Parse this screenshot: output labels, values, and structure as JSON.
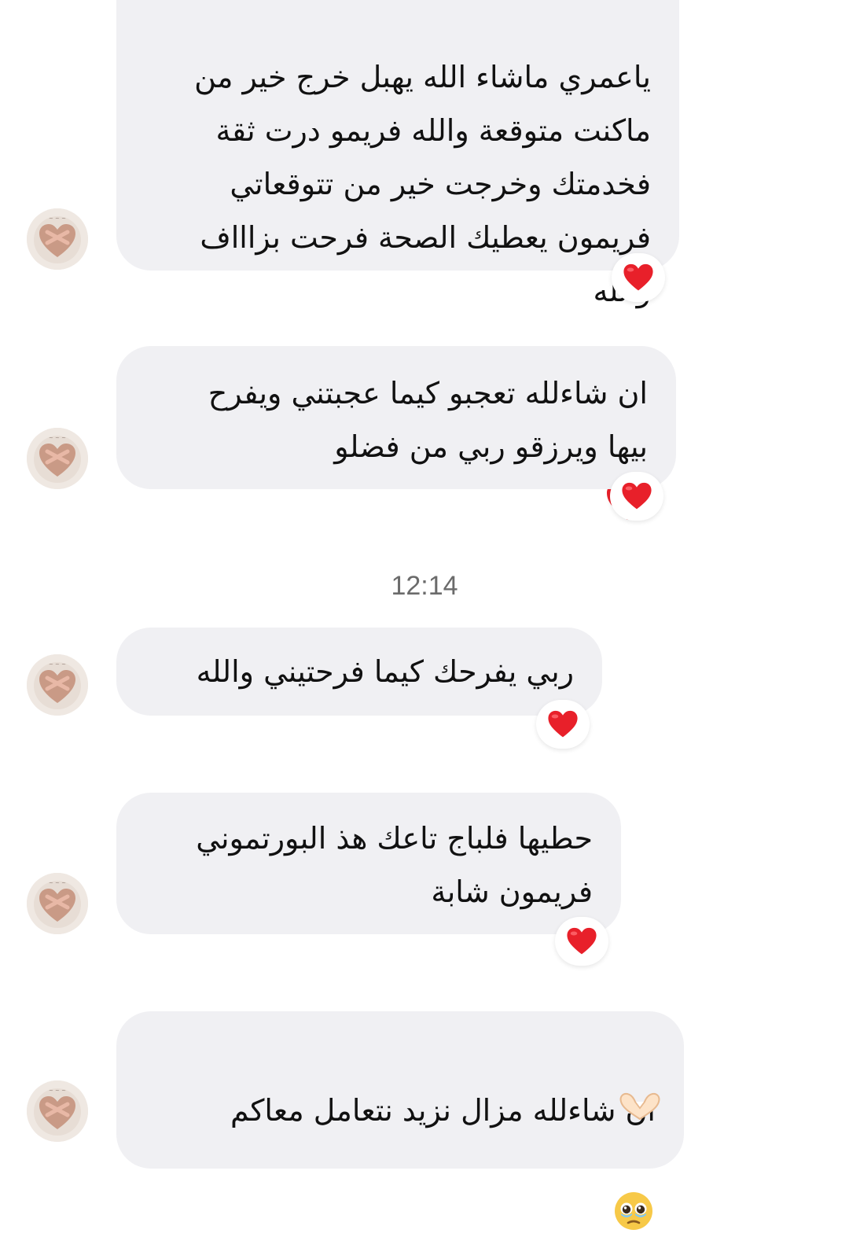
{
  "timestamp": "12:14",
  "messages": [
    {
      "lines": "ياعمري ماشاء الله يهبل خرج خير من\nماكنت متوقعة والله فريمو درت ثقة\nفخدمتك وخرجت خير من تتوقعاتي\nفريمون يعطيك الصحة فرحت بزاااف\nوالله",
      "trailing_emojis": [
        "pleading-face",
        "red-heart"
      ],
      "reaction": "red-heart"
    },
    {
      "lines": "ان شاءلله تعجبو كيما عجبتني ويفرح\nبيها ويرزقو ربي من فضلو",
      "trailing_emojis": [],
      "reaction": "red-heart"
    },
    {
      "lines": "ربي يفرحك كيما فرحتيني والله",
      "trailing_emojis": [],
      "reaction": "red-heart"
    },
    {
      "lines": "حطيها فلباج تاعك هذ البورتموني\nفريمون شابة",
      "trailing_emojis": [],
      "reaction": "red-heart"
    },
    {
      "lines": "ان شاءلله مزال نزيد نتعامل معاكم",
      "trailing_emojis": [
        "face-holding-back-tears"
      ],
      "reaction": "heart-hands"
    }
  ],
  "colors": {
    "bubble": "#f0f0f3",
    "text": "#111111",
    "timestamp": "#6b6b6b",
    "heart": "#e8202a"
  }
}
